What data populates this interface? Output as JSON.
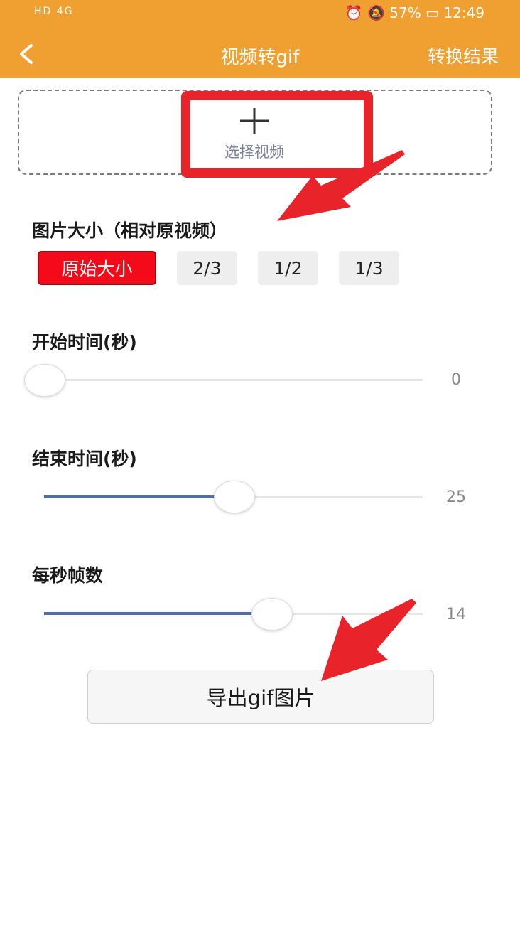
{
  "status_bar": {
    "left": "HD 4G",
    "battery_percent": "57%",
    "time": "12:49"
  },
  "header": {
    "back_icon": "chevron-left-icon",
    "title": "视频转gif",
    "results_label": "转换结果"
  },
  "video_picker": {
    "icon": "plus-icon",
    "label": "选择视频"
  },
  "image_size": {
    "title": "图片大小（相对原视频）",
    "options": [
      {
        "label": "原始大小",
        "selected": true
      },
      {
        "label": "2/3",
        "selected": false
      },
      {
        "label": "1/2",
        "selected": false
      },
      {
        "label": "1/3",
        "selected": false
      }
    ]
  },
  "start_time": {
    "title": "开始时间(秒)",
    "value": "0",
    "fraction": 0.0
  },
  "end_time": {
    "title": "结束时间(秒)",
    "value": "25",
    "fraction": 0.5
  },
  "fps": {
    "title": "每秒帧数",
    "value": "14",
    "fraction": 0.6
  },
  "export_button": {
    "label": "导出gif图片"
  },
  "colors": {
    "header": "#f0a030",
    "selected_chip": "#f40a18",
    "slider_fill": "#4a6fb0",
    "annotation": "#e8232a"
  }
}
